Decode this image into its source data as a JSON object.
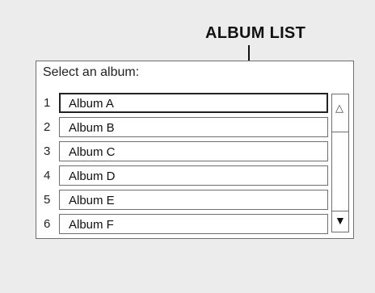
{
  "callout_label": "ALBUM LIST",
  "prompt": "Select an album:",
  "albums": [
    {
      "number": "1",
      "name": "Album A"
    },
    {
      "number": "2",
      "name": "Album B"
    },
    {
      "number": "3",
      "name": "Album C"
    },
    {
      "number": "4",
      "name": "Album D"
    },
    {
      "number": "5",
      "name": "Album E"
    },
    {
      "number": "6",
      "name": "Album F"
    }
  ],
  "selected_index": 0,
  "scrollbar": {
    "up_glyph": "△",
    "down_glyph": "▼"
  }
}
